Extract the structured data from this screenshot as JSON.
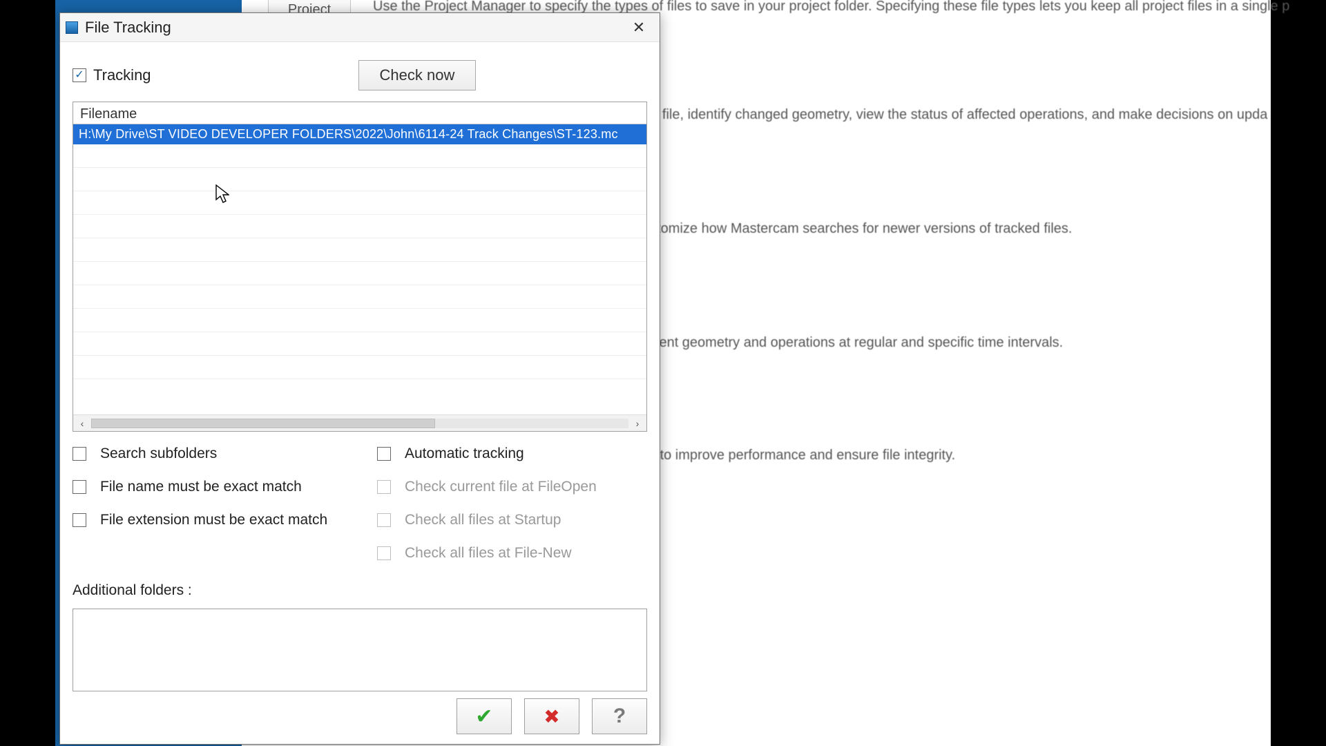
{
  "background": {
    "tab_label": "Project",
    "line1": "Use the Project Manager to specify the types of files to save in your project folder. Specifying these file types lets you keep all project files in a single p",
    "line2": "art file, identify changed geometry, view the status of affected operations, and make decisions on upda",
    "line3": "ustomize how Mastercam searches for newer versions of tracked files.",
    "line4": "urrent geometry and operations at regular and specific time intervals.",
    "line5": "ile to improve performance and ensure file integrity."
  },
  "dialog": {
    "title": "File Tracking",
    "tracking_label": "Tracking",
    "check_now_label": "Check now",
    "list_header": "Filename",
    "selected_file": "H:\\My Drive\\ST VIDEO DEVELOPER FOLDERS\\2022\\John\\6114-24 Track Changes\\ST-123.mc",
    "opts_left": {
      "search_subfolders": "Search subfolders",
      "filename_exact": "File name must be exact match",
      "fileext_exact": "File extension must be exact match"
    },
    "opts_right": {
      "auto_tracking": "Automatic tracking",
      "check_fileopen": "Check current file at FileOpen",
      "check_startup": "Check all files at Startup",
      "check_filenew": "Check all files at File-New"
    },
    "additional_folders_label": "Additional folders :"
  }
}
